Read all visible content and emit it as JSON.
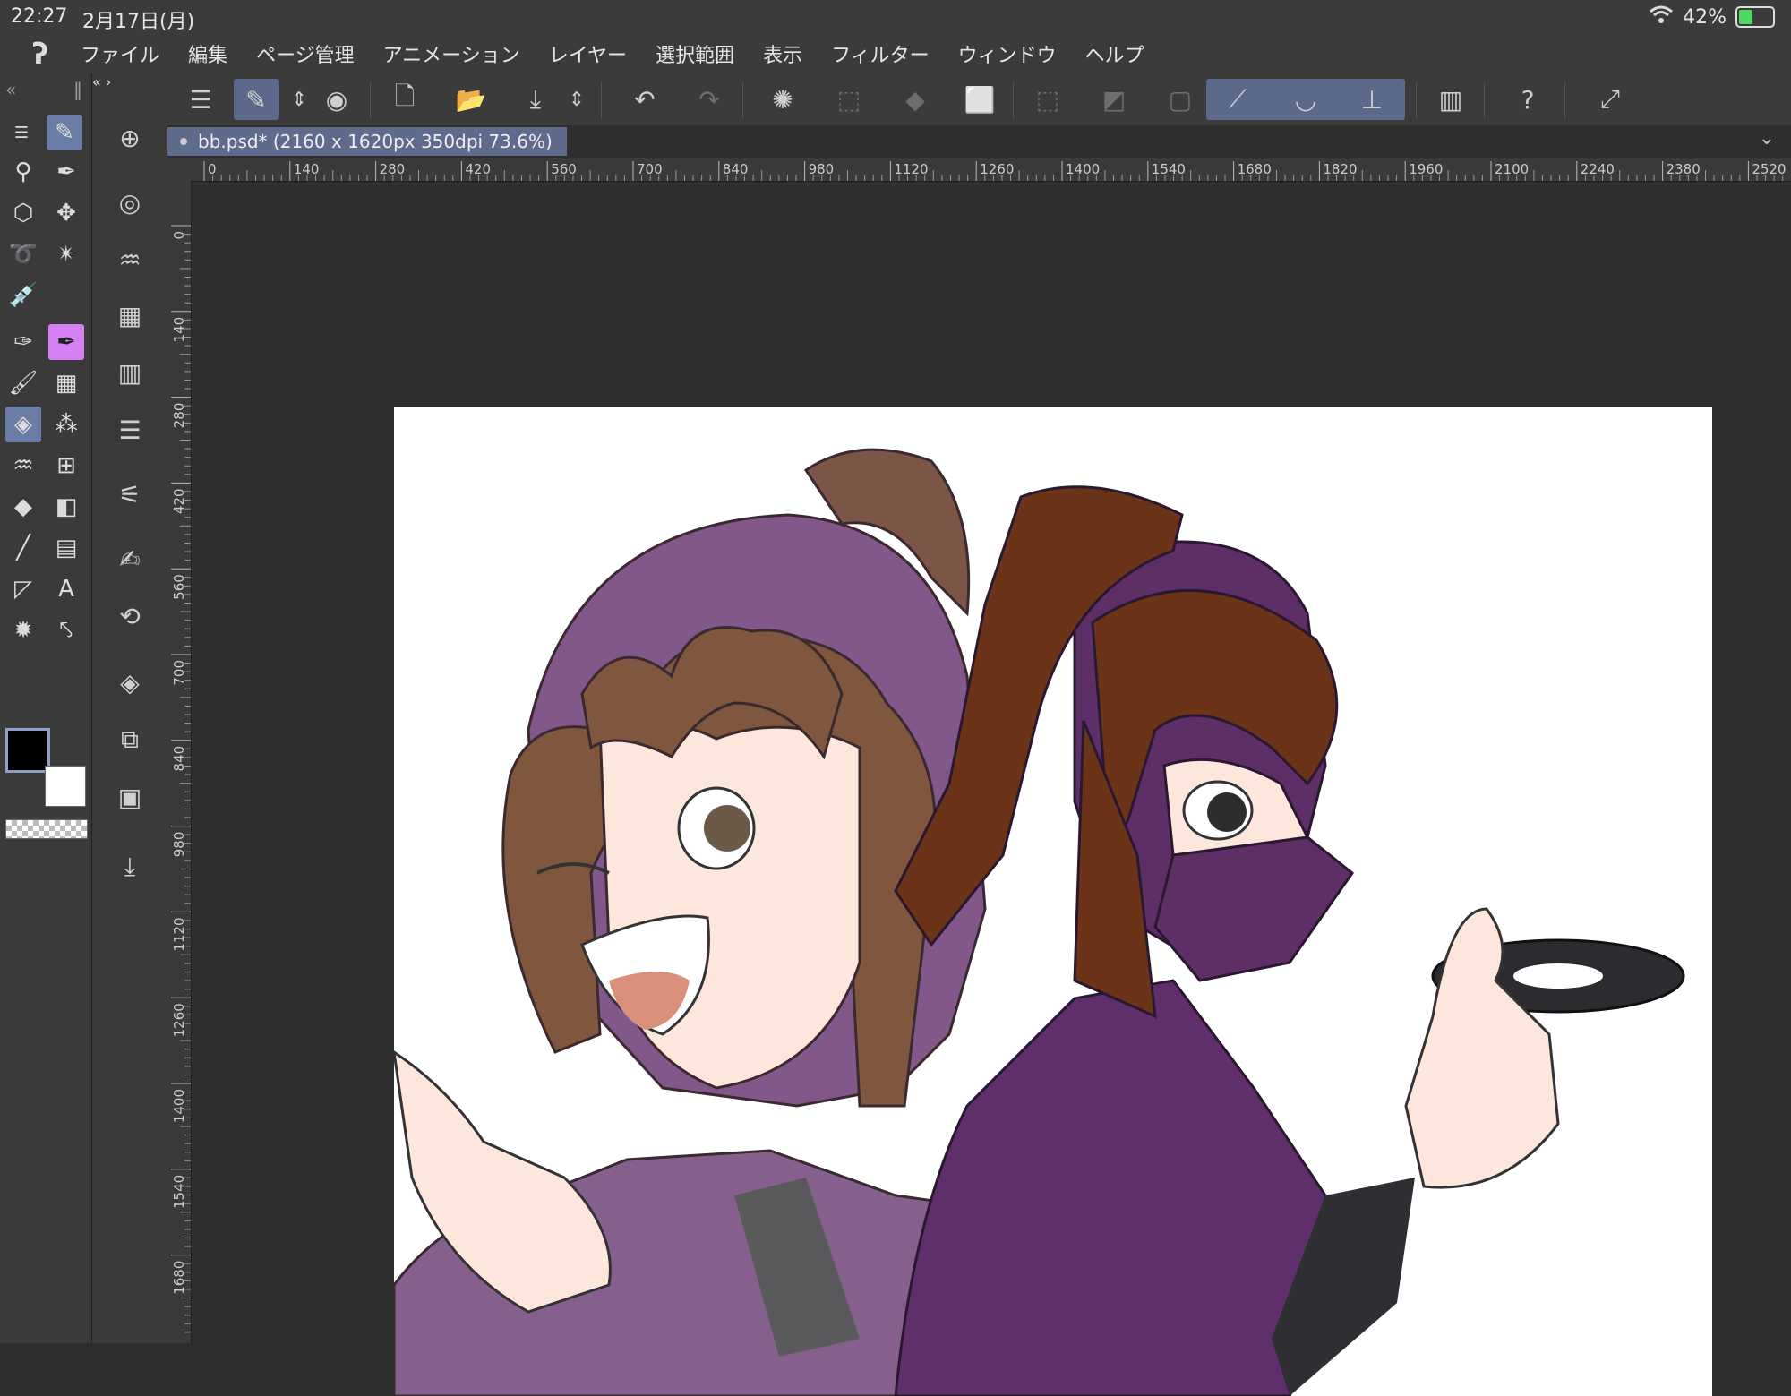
{
  "status": {
    "time": "22:27",
    "date": "2月17日(月)",
    "battery": "42%",
    "battery_level": 0.42
  },
  "menu": [
    "ファイル",
    "編集",
    "ページ管理",
    "アニメーション",
    "レイヤー",
    "選択範囲",
    "表示",
    "フィルター",
    "ウィンドウ",
    "ヘルプ"
  ],
  "document": {
    "tab_label": "bb.psd* (2160 x 1620px 350dpi 73.6%)"
  },
  "ruler": {
    "top": [
      "0",
      "140",
      "280",
      "420",
      "560",
      "700",
      "840",
      "980",
      "1120",
      "1260",
      "1400",
      "1540",
      "1680",
      "1820",
      "1960",
      "2100",
      "2240",
      "2380",
      "2520"
    ],
    "left": [
      "0",
      "140",
      "280",
      "420",
      "560",
      "700",
      "840",
      "980",
      "1120",
      "1260",
      "1400",
      "1540",
      "1680"
    ]
  },
  "colors": {
    "accent": "#5b6a8a",
    "pen_highlight": "#d580f2",
    "foreground": "#000000",
    "background": "#ffffff"
  }
}
